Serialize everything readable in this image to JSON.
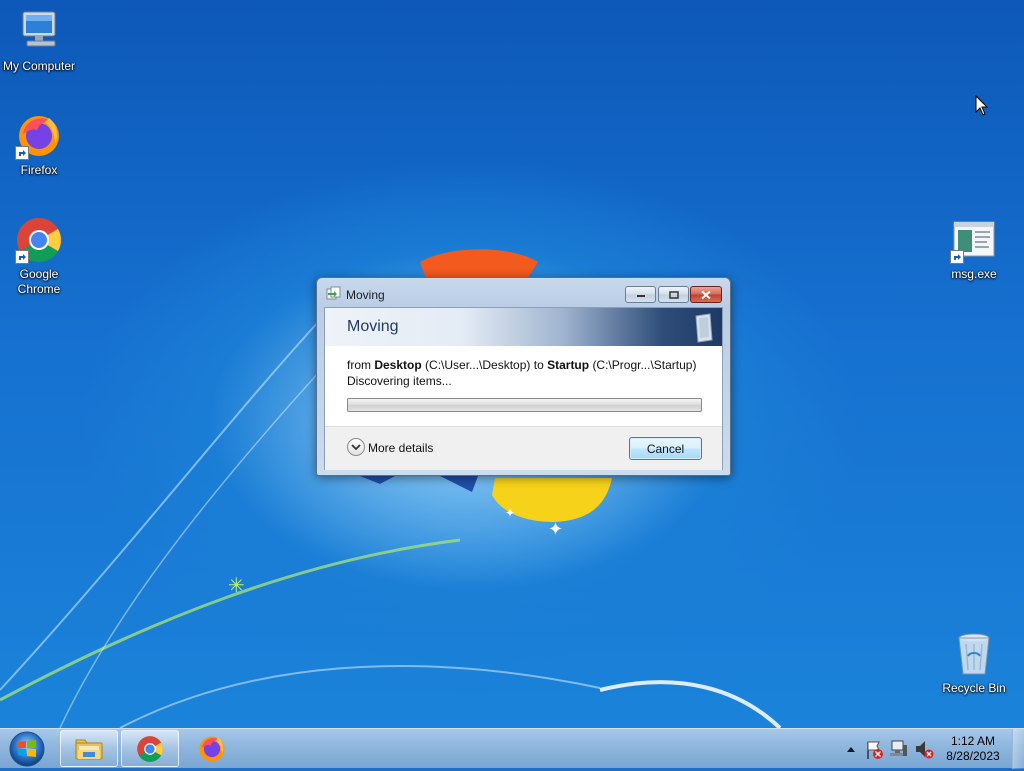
{
  "desktop": {
    "icons": [
      {
        "label": "My Computer"
      },
      {
        "label": "Firefox"
      },
      {
        "label": "Google Chrome"
      },
      {
        "label": "msg.exe"
      },
      {
        "label": "Recycle Bin"
      }
    ]
  },
  "dialog": {
    "window_title": "Moving",
    "header": "Moving",
    "from_prefix": "from",
    "source_name": "Desktop",
    "source_path": "(C:\\User...\\Desktop)",
    "to_word": "to",
    "dest_name": "Startup",
    "dest_path": "(C:\\Progr...\\Startup)",
    "status": "Discovering items...",
    "progress_percent": 0,
    "more_details_label": "More details",
    "cancel_label": "Cancel"
  },
  "taskbar": {
    "pinned": [
      {
        "icon": "windows-explorer-icon"
      },
      {
        "icon": "chrome-icon"
      },
      {
        "icon": "firefox-icon"
      }
    ],
    "tray_icons": [
      "show-hidden-icons-chevron",
      "action-center-flag-icon",
      "network-icon",
      "volume-muted-icon"
    ],
    "time": "1:12 AM",
    "date": "8/28/2023"
  },
  "colors": {
    "desktop_blue": "#1670cf",
    "cancel_button": "#bee6fd",
    "close_button": "#c0402e"
  }
}
